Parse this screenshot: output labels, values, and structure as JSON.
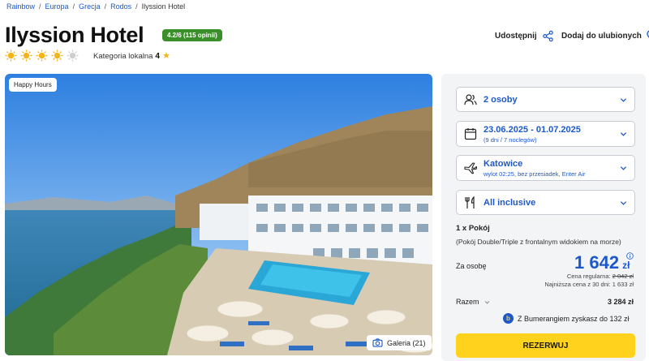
{
  "breadcrumb": [
    "Rainbow",
    "Europa",
    "Grecja",
    "Rodos",
    "Ilyssion Hotel"
  ],
  "hotel": {
    "name": "Ilyssion Hotel",
    "rating": "4.2/6 (115 opinii)",
    "sun_rating": 4,
    "sun_max": 5,
    "category_label": "Kategoria lokalna",
    "category_value": "4"
  },
  "actions": {
    "share": "Udostępnij",
    "favorite": "Dodaj do ulubionych"
  },
  "photo": {
    "badge": "Happy Hours",
    "gallery": "Galeria (21)"
  },
  "booking": {
    "persons": "2 osoby",
    "dates": "23.06.2025 - 01.07.2025",
    "dates_sub": "(9 dni / 7 noclegów)",
    "departure": "Katowice",
    "departure_sub": "wylot 02:25, bez przesiadek, Enter Air",
    "board": "All inclusive",
    "rooms": "1 x Pokój",
    "room_desc": "(Pokój Double/Triple z frontalnym widokiem na morze)",
    "per_person_label": "Za osobę",
    "price": "1 642",
    "currency": "zł",
    "regular_label": "Cena regularna:",
    "regular_price": "2 042 zł",
    "lowest": "Najniższa cena z 30 dni: 1 633 zł",
    "total_label": "Razem",
    "total_value": "3 284 zł",
    "bumerang": "Z Bumerangiem zyskasz do 132 zł",
    "reserve": "REZERWUJ"
  },
  "colors": {
    "accent": "#1c58c9",
    "cta": "#ffd21e",
    "rating_badge": "#3a8f2a",
    "sun": "#f3b51b"
  }
}
